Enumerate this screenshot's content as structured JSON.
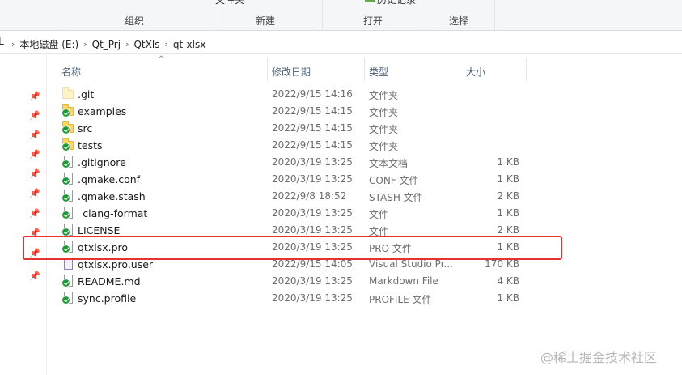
{
  "ribbon": {
    "cut_top_left": "文件夹",
    "cut_top_right": "历史记录",
    "groups": [
      "组织",
      "新建",
      "打开",
      "选择"
    ]
  },
  "address": {
    "edge_glyph": "L",
    "crumbs": [
      "本地磁盘 (E:)",
      "Qt_Prj",
      "QtXls",
      "qt-xlsx"
    ],
    "separator": "›"
  },
  "columns": {
    "name": "名称",
    "date": "修改日期",
    "type": "类型",
    "size": "大小",
    "sort_indicator": "^"
  },
  "pins": [
    "pin-icon",
    "pin-icon",
    "pin-icon",
    "pin-icon",
    "pin-icon",
    "pin-icon",
    "pin-icon",
    "pin-icon",
    "pin-icon",
    "pin-icon"
  ],
  "files": [
    {
      "icon": "folder-hidden-icon",
      "name": ".git",
      "date": "2022/9/15 14:16",
      "type": "文件夹",
      "size": ""
    },
    {
      "icon": "folder-synced-icon",
      "name": "examples",
      "date": "2022/9/15 14:15",
      "type": "文件夹",
      "size": ""
    },
    {
      "icon": "folder-synced-icon",
      "name": "src",
      "date": "2022/9/15 14:15",
      "type": "文件夹",
      "size": ""
    },
    {
      "icon": "folder-synced-icon",
      "name": "tests",
      "date": "2022/9/15 14:15",
      "type": "文件夹",
      "size": ""
    },
    {
      "icon": "file-synced-icon",
      "name": ".gitignore",
      "date": "2020/3/19 13:25",
      "type": "文本文档",
      "size": "1 KB"
    },
    {
      "icon": "file-synced-icon",
      "name": ".qmake.conf",
      "date": "2020/3/19 13:25",
      "type": "CONF 文件",
      "size": "1 KB"
    },
    {
      "icon": "file-synced-icon",
      "name": ".qmake.stash",
      "date": "2022/9/8 18:52",
      "type": "STASH 文件",
      "size": "2 KB"
    },
    {
      "icon": "file-synced-icon",
      "name": "_clang-format",
      "date": "2020/3/19 13:25",
      "type": "文件",
      "size": "1 KB"
    },
    {
      "icon": "file-synced-icon",
      "name": "LICENSE",
      "date": "2020/3/19 13:25",
      "type": "文件",
      "size": "2 KB"
    },
    {
      "icon": "file-synced-icon",
      "name": "qtxlsx.pro",
      "date": "2020/3/19 13:25",
      "type": "PRO 文件",
      "size": "1 KB"
    },
    {
      "icon": "vs-file-icon",
      "name": "qtxlsx.pro.user",
      "date": "2022/9/15 14:05",
      "type": "Visual Studio Pr...",
      "size": "170 KB"
    },
    {
      "icon": "file-synced-icon",
      "name": "README.md",
      "date": "2020/3/19 13:25",
      "type": "Markdown File",
      "size": "4 KB"
    },
    {
      "icon": "file-synced-icon",
      "name": "sync.profile",
      "date": "2020/3/19 13:25",
      "type": "PROFILE 文件",
      "size": "1 KB"
    }
  ],
  "highlighted_file": "qtxlsx.pro",
  "colors": {
    "highlight": "#e8322f",
    "header_text": "#4c607a",
    "sync_check": "#1e9b36",
    "folder": "#fcd862"
  },
  "watermark": "@稀土掘金技术社区"
}
